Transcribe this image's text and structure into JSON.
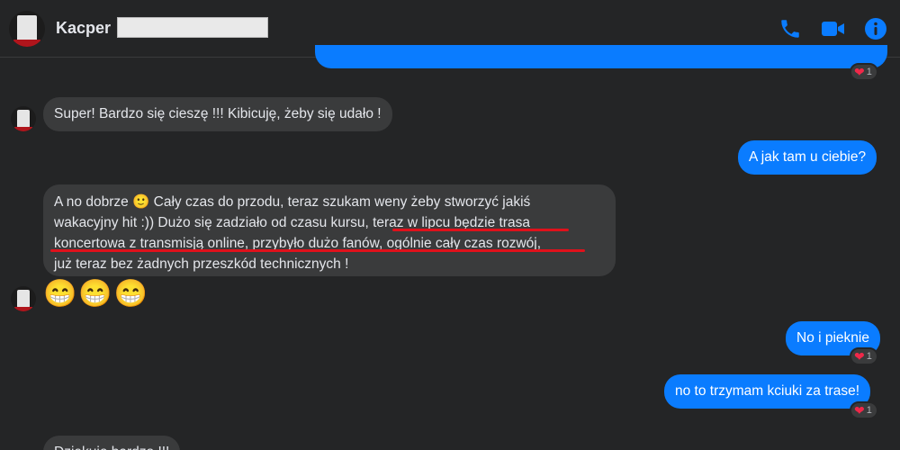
{
  "header": {
    "contact_name": "Kacper"
  },
  "icons": {
    "call": "phone-icon",
    "video": "video-camera-icon",
    "info": "info-icon"
  },
  "colors": {
    "outgoing_bubble": "#0a7cff",
    "incoming_bubble": "#3a3b3c",
    "background": "#242526",
    "accent": "#0a7cff",
    "highlight_underline": "#e0111b",
    "reaction_heart": "#f02849"
  },
  "messages": [
    {
      "id": "m1",
      "from": "them",
      "text": "Super! Bardzo się cieszę !!! Kibicuję, żeby się udało !"
    },
    {
      "id": "m2",
      "from": "me",
      "text": "A jak tam u ciebie?"
    },
    {
      "id": "m3",
      "from": "them",
      "lines": [
        "A no dobrze 🙂 Cały czas do przodu, teraz szukam weny żeby stworzyć jakiś",
        "wakacyjny hit :)) Dużo się zadziało od czasu kursu, teraz w lipcu będzie trasa",
        "koncertowa z transmisją online, przybyło dużo fanów, ogólnie cały czas rozwój,",
        "już teraz bez żadnych przeszkód technicznych !"
      ]
    },
    {
      "id": "m4",
      "from": "them",
      "text": "😁😁😁"
    },
    {
      "id": "m5",
      "from": "me",
      "text": "No i pieknie"
    },
    {
      "id": "m6",
      "from": "me",
      "text": "no to trzymam kciuki za trase!"
    },
    {
      "id": "m7",
      "from": "them",
      "text": "Dziękuje bardzo !!!"
    }
  ],
  "reactions": [
    {
      "emoji": "❤",
      "count": "1"
    },
    {
      "emoji": "❤",
      "count": "1"
    },
    {
      "emoji": "❤",
      "count": "1"
    }
  ]
}
